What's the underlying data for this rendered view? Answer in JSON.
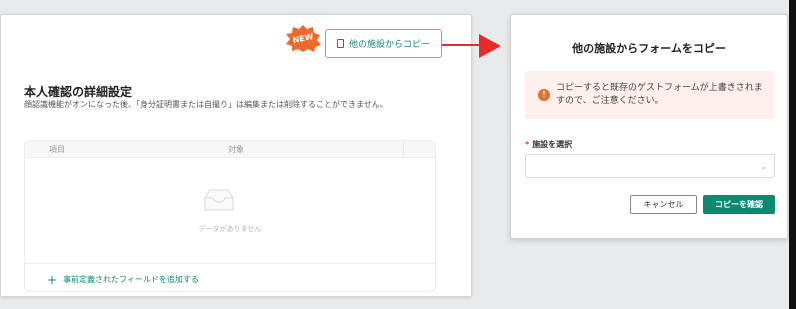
{
  "panel": {
    "new_badge": "NEW",
    "copy_button_label": "他の施設からコピー",
    "title": "本人確認の詳細設定",
    "description": "顔認識機能がオンになった後、「身分証明書または自撮り」は編集または削除することができません。",
    "table": {
      "columns": [
        "項目",
        "対象"
      ],
      "empty_text": "データがありません"
    },
    "add_field_label": "事前定義されたフィールドを追加する"
  },
  "modal": {
    "title": "他の施設からフォームをコピー",
    "alert_text": "コピーすると既存のゲストフォームが上書きされますので、ご注意ください。",
    "field_label": "施設を選択",
    "select_value": "",
    "cancel_label": "キャンセル",
    "confirm_label": "コピーを確認"
  },
  "colors": {
    "accent": "#0c8a6f",
    "highlight_border": "#f07a7a",
    "arrow": "#e52b2b",
    "badge": "#ee6a2c",
    "alert_bg": "#fdf0ec"
  },
  "icons": {
    "copy": "document-icon",
    "alert": "info-icon",
    "empty": "empty-inbox-icon",
    "select": "chevron-down-icon"
  }
}
